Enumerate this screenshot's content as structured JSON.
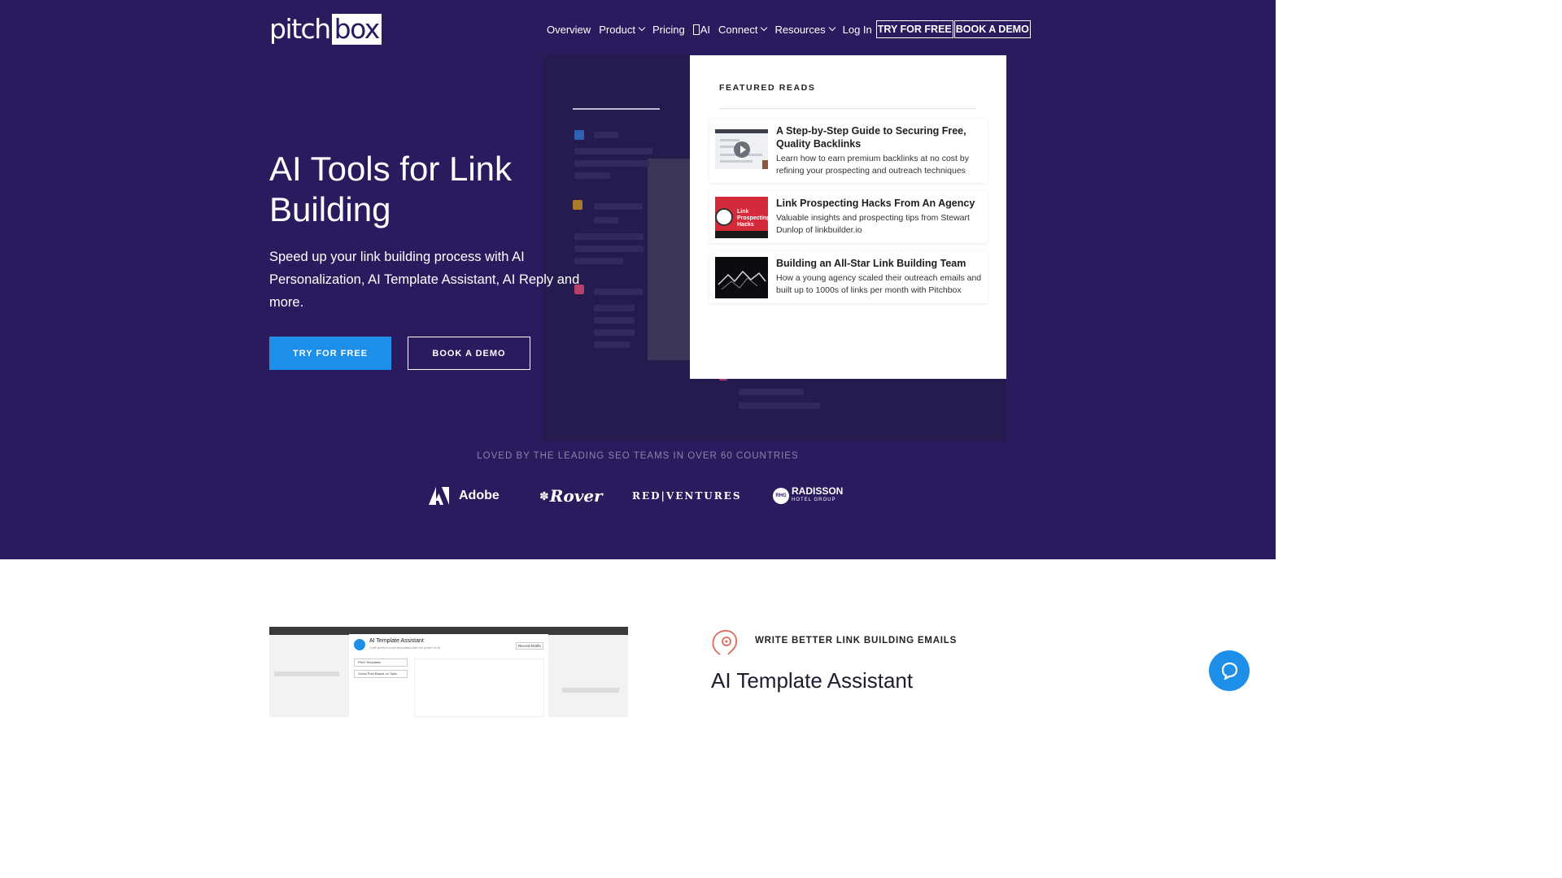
{
  "brand": {
    "logo_text": "pitch",
    "logo_box": "box"
  },
  "nav": {
    "items": [
      {
        "label": "Overview",
        "dropdown": false
      },
      {
        "label": "Product",
        "dropdown": true
      },
      {
        "label": "Pricing",
        "dropdown": false
      },
      {
        "label": "AI",
        "dropdown": false
      },
      {
        "label": "Connect",
        "dropdown": true
      },
      {
        "label": "Resources",
        "dropdown": true
      },
      {
        "label": "Log In",
        "dropdown": false
      }
    ],
    "try_label": "TRY FOR FREE",
    "demo_label": "BOOK A DEMO"
  },
  "dropdown": {
    "featured_title": "FEATURED READS",
    "cards": [
      {
        "title": "A Step-by-Step Guide to Securing Free, Quality Backlinks",
        "desc": "Learn how to earn premium backlinks at no cost by refining your prospecting and outreach techniques"
      },
      {
        "title": "Link Prospecting Hacks From An Agency",
        "desc": "Valuable insights and prospecting tips from Stewart Dunlop of linkbuilder.io",
        "thumb_text": "Link Prospecting Hacks"
      },
      {
        "title": "Building an All-Star Link Building Team",
        "desc": "How a young agency scaled their outreach emails and built up to 1000s of links per month with Pitchbox"
      }
    ]
  },
  "hero": {
    "title": "AI Tools for Link Building",
    "subtitle": "Speed up your link building process with AI Personalization, AI Template Assistant, AI Reply and more.",
    "try_button": "TRY FOR FREE",
    "demo_button": "BOOK A DEMO"
  },
  "loved": {
    "text": "LOVED BY THE LEADING SEO TEAMS IN OVER 60 COUNTRIES"
  },
  "logos": {
    "adobe": "Adobe",
    "rover": "Rover",
    "red_ventures": "RED|VENTURES",
    "radisson": "RADISSON",
    "radisson_sub": "HOTEL GROUP",
    "radisson_mark": "RHG"
  },
  "feature": {
    "label": "WRITE BETTER LINK BUILDING EMAILS",
    "title": "AI Template Assistant",
    "modal_title": "AI Template Assistant",
    "modal_sub": "Craft perfect email templates with the power of AI",
    "modal_field1": "Pitch Templates",
    "modal_field2": "Guest Post Based on Topic",
    "modal_btn": "Record Drafts"
  },
  "colors": {
    "hero_bg": "#2a1a5e",
    "accent": "#1e8fe8",
    "white": "#ffffff"
  }
}
